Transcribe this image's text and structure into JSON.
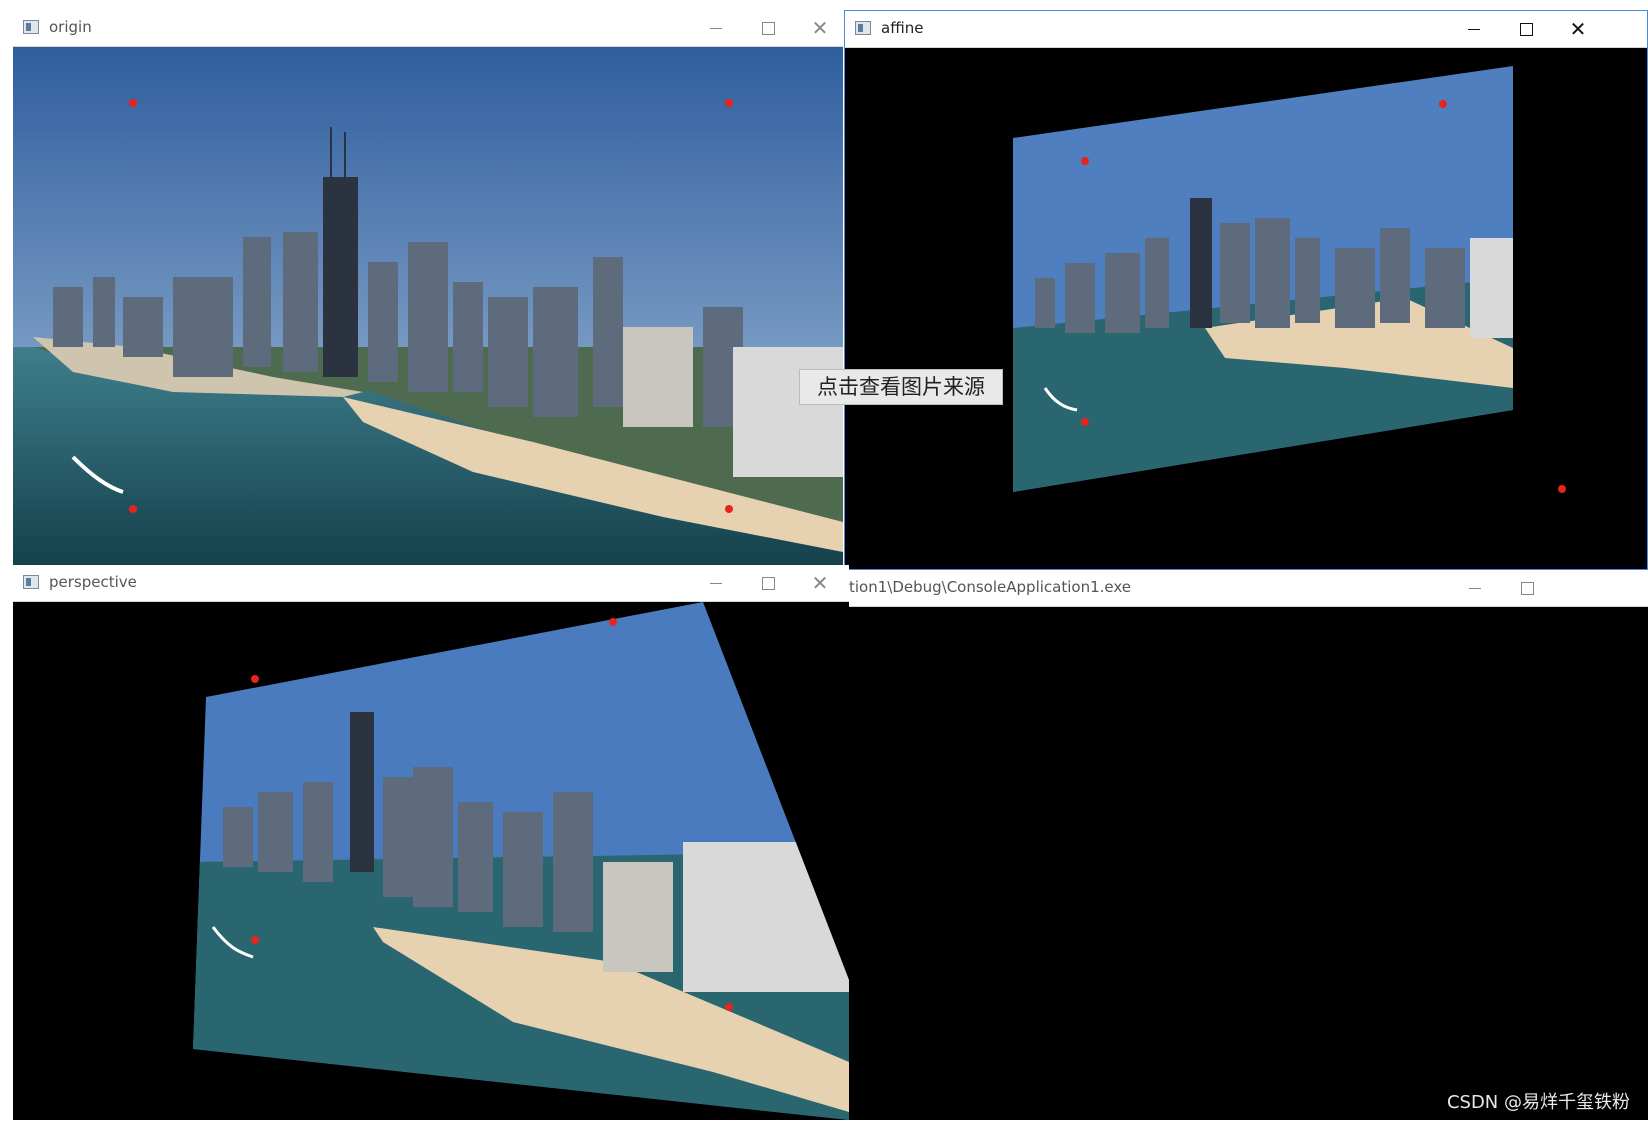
{
  "windows": {
    "origin": {
      "title": "origin"
    },
    "affine": {
      "title": "affine"
    },
    "perspective": {
      "title": "perspective"
    },
    "console": {
      "title": "tion1\\Debug\\ConsoleApplication1.exe"
    }
  },
  "overlay": {
    "source_button": "点击查看图片来源"
  },
  "watermark": "CSDN @易烊千玺铁粉",
  "icons": [
    "window-app-icon",
    "minimize-icon",
    "maximize-icon",
    "close-icon"
  ],
  "colors": {
    "marker": "#e8231c",
    "sky": "#3f6fb0",
    "water": "#1f5a66",
    "sand": "#e6d2b0"
  }
}
